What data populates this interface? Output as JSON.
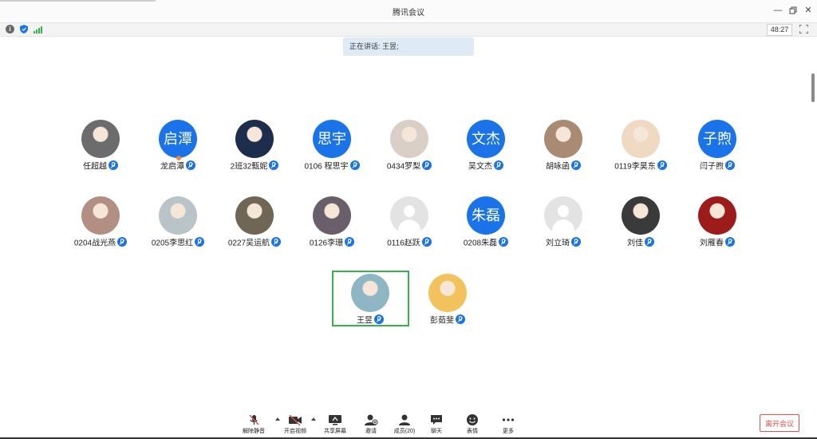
{
  "window": {
    "title": "腾讯会议"
  },
  "status": {
    "timer": "48:27"
  },
  "speaking": {
    "text": "正在讲话: 王昱;"
  },
  "participants": [
    {
      "name": "任超越",
      "avatar_type": "photo",
      "avatar_color": "#6c6c6c"
    },
    {
      "name": "龙启潭",
      "avatar_type": "text",
      "avatar_text": "启潭"
    },
    {
      "name": "2班32甄妮",
      "avatar_type": "photo",
      "avatar_color": "#1d2d4d"
    },
    {
      "name": "0106  程思宇",
      "avatar_type": "text",
      "avatar_text": "思宇"
    },
    {
      "name": "0434罗梨",
      "avatar_type": "photo",
      "avatar_color": "#d9cfc7"
    },
    {
      "name": "吴文杰",
      "avatar_type": "text",
      "avatar_text": "文杰"
    },
    {
      "name": "胡咏函",
      "avatar_type": "photo",
      "avatar_color": "#a98a72"
    },
    {
      "name": "0119李昊东",
      "avatar_type": "photo",
      "avatar_color": "#efd9c3"
    },
    {
      "name": "闫子煦",
      "avatar_type": "text",
      "avatar_text": "子煦"
    },
    {
      "name": "0204战光燕",
      "avatar_type": "photo",
      "avatar_color": "#b28f82"
    },
    {
      "name": "0205李思红",
      "avatar_type": "photo",
      "avatar_color": "#b8c4c8"
    },
    {
      "name": "0227吴运航",
      "avatar_type": "photo",
      "avatar_color": "#6f6656"
    },
    {
      "name": "0126李珊",
      "avatar_type": "photo",
      "avatar_color": "#6a5e6b"
    },
    {
      "name": "0116赵跃",
      "avatar_type": "default"
    },
    {
      "name": "0208朱磊",
      "avatar_type": "text",
      "avatar_text": "朱磊"
    },
    {
      "name": "刘立琦",
      "avatar_type": "default"
    },
    {
      "name": "刘佳",
      "avatar_type": "photo",
      "avatar_color": "#3a3a3a"
    },
    {
      "name": "刘雁春",
      "avatar_type": "photo",
      "avatar_color": "#9e1b1b"
    },
    {
      "name": "王昱",
      "avatar_type": "photo",
      "avatar_color": "#8fb6c4"
    },
    {
      "name": "彭茹斐",
      "avatar_type": "photo",
      "avatar_color": "#f2c25c"
    }
  ],
  "toolbar": {
    "unmute": "解除静音",
    "start_video": "开启视频",
    "share_screen": "共享屏幕",
    "invite": "邀请",
    "members": "成员(20)",
    "chat": "聊天",
    "reactions": "表情",
    "more": "更多",
    "leave": "离开会议"
  },
  "colors": {
    "accent": "#1a73e8",
    "active_speaker": "#35b34a",
    "leave": "#e0504a"
  }
}
